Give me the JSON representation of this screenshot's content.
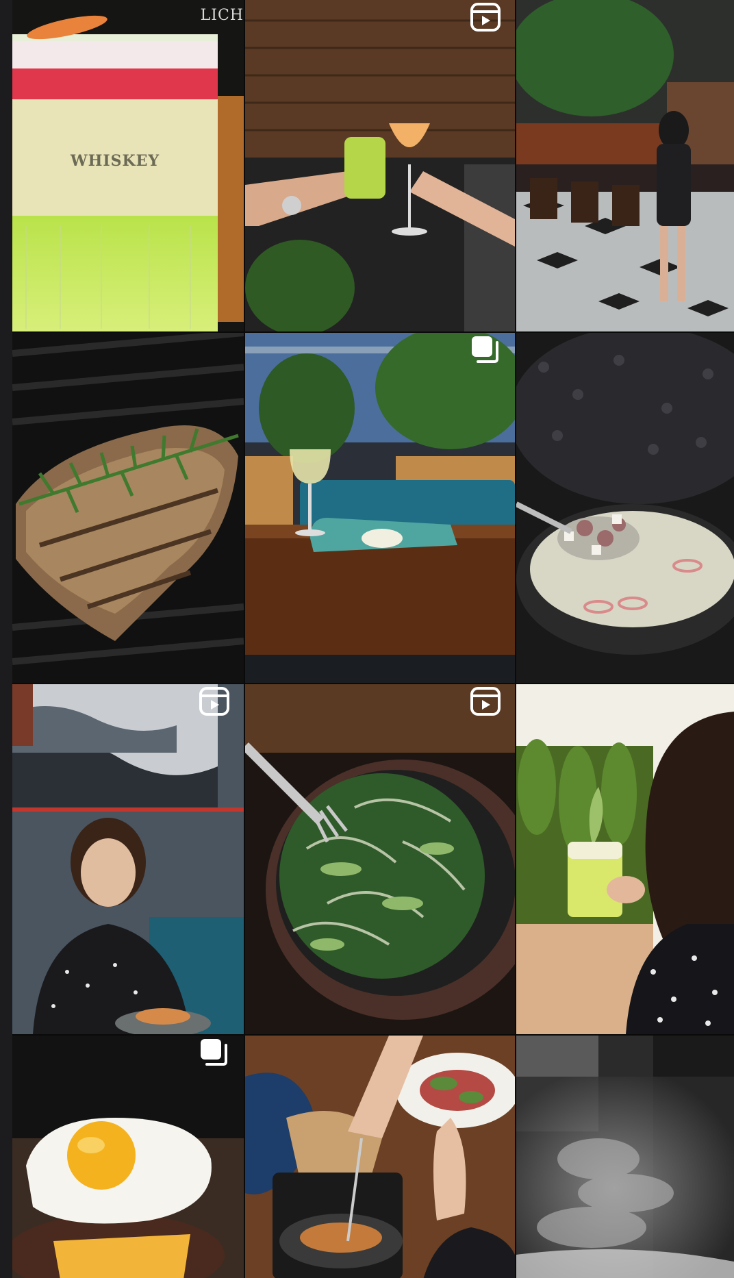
{
  "profile_grid": {
    "posts": [
      {
        "subject": "whiskey-cocktail",
        "label_text": "WHISKEY",
        "corner_text": "LICH",
        "type": "photo"
      },
      {
        "subject": "cheers-drinks",
        "type": "reel"
      },
      {
        "subject": "woman-restaurant-interior",
        "type": "photo"
      },
      {
        "subject": "grilled-steak-rosemary",
        "type": "photo"
      },
      {
        "subject": "wine-table-blue-sofa",
        "type": "carousel"
      },
      {
        "subject": "soup-bowl-spoon",
        "type": "photo"
      },
      {
        "subject": "woman-eating",
        "type": "reel"
      },
      {
        "subject": "greens-salad-pan",
        "type": "reel"
      },
      {
        "subject": "woman-holding-drink",
        "type": "photo"
      },
      {
        "subject": "burger-fried-egg",
        "type": "carousel"
      },
      {
        "subject": "hands-sharing-food",
        "type": "photo"
      },
      {
        "subject": "steam-monochrome",
        "type": "photo"
      }
    ]
  },
  "icons": {
    "reel": "reel-icon",
    "carousel": "carousel-icon"
  },
  "colors": {
    "background": "#1c1c1e",
    "badge": "#ffffff"
  }
}
